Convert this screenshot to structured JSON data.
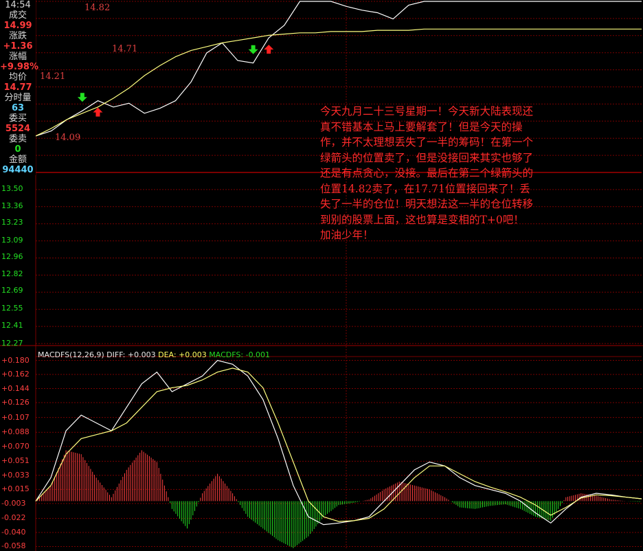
{
  "panel": {
    "time": "14:54",
    "volume_label": "成交",
    "volume_value": "14.99",
    "change_label": "涨跌",
    "change_value": "+1.36",
    "pct_label": "涨幅",
    "pct_value": "+9.98%",
    "avg_label": "均价",
    "avg_value": "14.77",
    "tick_vol_label": "分时量",
    "tick_vol_value": "63",
    "bid_label": "委买",
    "bid_value": "5524",
    "ask_label": "委卖",
    "ask_value": "0",
    "amount_label": "金额",
    "amount_value": "94440"
  },
  "colors": {
    "background": "#000000",
    "grid": "#7a0000",
    "price_line": "#ffffff",
    "avg_line": "#ffff80",
    "macd_pos": "#ff4040",
    "macd_neg": "#22dd22",
    "note_text": "#ff2a2a"
  },
  "chart_data": [
    {
      "type": "line",
      "name": "intraday-price",
      "y_ticks": [
        "13.50",
        "13.36",
        "13.23",
        "13.09",
        "12.96",
        "12.82",
        "12.69",
        "12.55",
        "12.41",
        "12.27"
      ],
      "ylim": [
        12.27,
        14.99
      ],
      "series": [
        {
          "name": "",
          "values": [
            13.92,
            13.96,
            14.05,
            14.12,
            14.2,
            14.15,
            14.18,
            14.1,
            14.14,
            14.2,
            14.35,
            14.58,
            14.66,
            14.52,
            14.5,
            14.7,
            14.8,
            14.99,
            14.99,
            14.99,
            14.95,
            14.92,
            14.9,
            14.85,
            14.96,
            14.99,
            14.99,
            14.99,
            14.99,
            14.99,
            14.99,
            14.99,
            14.99,
            14.99,
            14.99,
            14.99,
            14.99,
            14.99,
            14.99,
            14.99
          ]
        },
        {
          "name": "",
          "values": [
            13.92,
            13.98,
            14.05,
            14.1,
            14.15,
            14.22,
            14.3,
            14.4,
            14.48,
            14.55,
            14.6,
            14.63,
            14.66,
            14.68,
            14.7,
            14.72,
            14.73,
            14.74,
            14.74,
            14.75,
            14.75,
            14.75,
            14.76,
            14.76,
            14.76,
            14.77,
            14.77,
            14.77,
            14.77,
            14.77,
            14.77,
            14.77,
            14.77,
            14.77,
            14.77,
            14.77,
            14.77,
            14.77,
            14.77,
            14.77
          ]
        }
      ],
      "annotations": [
        {
          "text": "14.21",
          "kind": "sell",
          "x_index": 3
        },
        {
          "text": "14.09",
          "kind": "buy",
          "x_index": 4
        },
        {
          "text": "14.82",
          "kind": "sell",
          "x_index": 14
        },
        {
          "text": "14.71",
          "kind": "buy",
          "x_index": 15
        }
      ],
      "note": "今天九月二十三号星期一！今天新大陆表现还真不错基本上马上要解套了！但是今天的操作，并不太理想丢失了一半的筹码！在第一个绿箭头的位置卖了，但是没接回来其实也够了还是有点贪心，没接。最后在第二个绿箭头的位置14.82卖了，在17.71位置接回来了！丢失了一半的仓位！明天想法这一半的仓位转移到别的股票上面，这也算是变相的T+0吧！加油少年！"
    },
    {
      "type": "line",
      "name": "MACDFS",
      "title": "MACDFS(12,26,9)",
      "diff_label": "DIFF: ",
      "diff_value": "+0.003",
      "dea_label": "DEA: ",
      "dea_value": "+0.003",
      "macd_label": "MACDFS: ",
      "macd_value": "-0.001",
      "y_ticks": [
        "+0.180",
        "+0.162",
        "+0.144",
        "+0.126",
        "+0.107",
        "+0.088",
        "+0.070",
        "+0.051",
        "+0.033",
        "+0.015",
        "-0.003",
        "-0.022",
        "-0.040",
        "-0.058"
      ],
      "ylim": [
        -0.062,
        0.184
      ],
      "diff": [
        0.0,
        0.03,
        0.09,
        0.11,
        0.1,
        0.09,
        0.12,
        0.15,
        0.165,
        0.14,
        0.15,
        0.16,
        0.18,
        0.175,
        0.16,
        0.13,
        0.08,
        0.02,
        -0.02,
        -0.03,
        -0.028,
        -0.025,
        -0.02,
        0.0,
        0.02,
        0.04,
        0.05,
        0.045,
        0.03,
        0.02,
        0.015,
        0.01,
        0.0,
        -0.015,
        -0.028,
        -0.01,
        0.005,
        0.01,
        0.008,
        0.005,
        0.003
      ],
      "dea": [
        0.0,
        0.02,
        0.06,
        0.08,
        0.085,
        0.09,
        0.1,
        0.12,
        0.14,
        0.145,
        0.148,
        0.155,
        0.165,
        0.17,
        0.165,
        0.145,
        0.1,
        0.05,
        0.0,
        -0.02,
        -0.026,
        -0.025,
        -0.022,
        -0.01,
        0.01,
        0.03,
        0.045,
        0.045,
        0.035,
        0.025,
        0.018,
        0.012,
        0.005,
        -0.005,
        -0.018,
        -0.008,
        0.004,
        0.008,
        0.007,
        0.005,
        0.003
      ],
      "macd": [
        0.0,
        0.02,
        0.065,
        0.06,
        0.03,
        0.005,
        0.04,
        0.065,
        0.05,
        -0.01,
        -0.035,
        0.01,
        0.035,
        0.01,
        -0.02,
        -0.035,
        -0.05,
        -0.06,
        -0.045,
        -0.02,
        -0.005,
        -0.002,
        0.002,
        0.015,
        0.025,
        0.02,
        0.015,
        0.005,
        -0.008,
        -0.01,
        -0.006,
        -0.004,
        -0.01,
        -0.02,
        -0.025,
        0.005,
        0.01,
        0.007,
        0.002,
        0.0,
        -0.001
      ]
    }
  ]
}
